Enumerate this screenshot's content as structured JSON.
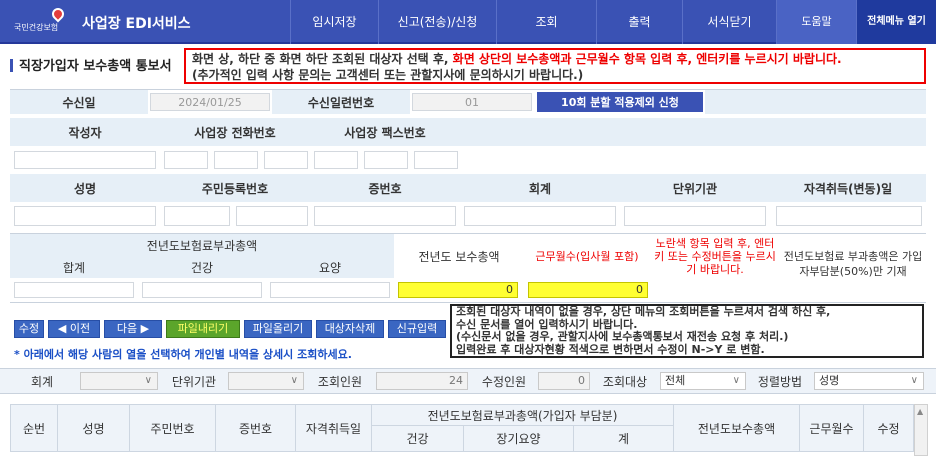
{
  "header": {
    "logo_text": "국민건강보험",
    "service_title": "사업장 EDI서비스",
    "menu": [
      "임시저장",
      "신고(전송)/신청",
      "조회",
      "출력",
      "서식닫기",
      "도움말",
      "전체메뉴 열기"
    ]
  },
  "page_title": "직장가입자 보수총액 통보서",
  "notice": {
    "line1_a": "화면 상, 하단 중 화면 하단 조회된 대상자 선택 후, ",
    "line1_b": "화면 상단의 보수총액과 근무월수 항목 입력 후, 엔터키를 누르시기 바랍니다.",
    "line2": "(추가적인 입력 사항 문의는 고객센터 또는 관할지사에 문의하시기 바랍니다.)"
  },
  "receive": {
    "date_label": "수신일",
    "date_value": "2024/01/25",
    "serial_label": "수신일련번호",
    "serial_value": "01",
    "apply_button": "10회 분할 적용제외 신청"
  },
  "author_section": {
    "writer_label": "작성자",
    "phone_label": "사업장 전화번호",
    "fax_label": "사업장 팩스번호"
  },
  "person_section": {
    "name_label": "성명",
    "rrn_label": "주민등록번호",
    "cert_label": "증번호",
    "unit_label": "회계",
    "org_label": "단위기관",
    "date_label": "자격취득(변동)일"
  },
  "premium": {
    "group_label": "전년도보험료부과총액",
    "sum_label": "합계",
    "health_label": "건강",
    "care_label": "요양",
    "prev_pay_label": "전년도 보수총액",
    "months_label": "근무월수(입사월 포함)",
    "prev_pay_value": "0",
    "months_value": "0",
    "yellow_hint": "노란색 항목 입력 후, 엔터키 또는 수정버튼을 누르시기 바랍니다.",
    "note": "전년도보험료 부과총액은 가입자부담분(50%)만 기재"
  },
  "toolbar": {
    "buttons": [
      "수정",
      "◀ 이전",
      "다음 ▶",
      "파일내리기",
      "파일올리기",
      "대상자삭제",
      "신규입력"
    ],
    "hint": "* 아래에서 해당 사람의 열을 선택하여 개인별 내역을 상세시 조회하세요.",
    "info_line1": "조회된 대상자 내역이 없을 경우, 상단 메뉴의 조회버튼을 누르셔서 검색 하신 후,",
    "info_line2": "수신 문서를 열어 입력하시기 바랍니다.",
    "info_line3": "(수신문서 없을 경우, 관할지사에 보수총액통보서 재전송 요청 후 처리.)",
    "info_line4": "입력완료 후 대상자현황 적색으로 변하면서 수정이 N->Y 로 변함."
  },
  "filter": {
    "unit_label": "회계",
    "org_label": "단위기관",
    "query_count_label": "조회인원",
    "query_count": "24",
    "edit_count_label": "수정인원",
    "edit_count": "0",
    "target_label": "조회대상",
    "target_value": "전체",
    "sort_label": "정렬방법",
    "sort_value": "성명"
  },
  "table": {
    "headers": [
      "순번",
      "성명",
      "주민번호",
      "증번호",
      "자격취득일",
      "전년도보험료부과총액(가입자 부담분)",
      "전년도보수총액",
      "근무월수",
      "수정"
    ],
    "sub_headers": [
      "건강",
      "장기요양",
      "계"
    ]
  },
  "colors": {
    "header_bg": "#3a52b4",
    "label_bg": "#e6eff7",
    "yellow": "#ffff33",
    "notice_red": "#e00000"
  }
}
